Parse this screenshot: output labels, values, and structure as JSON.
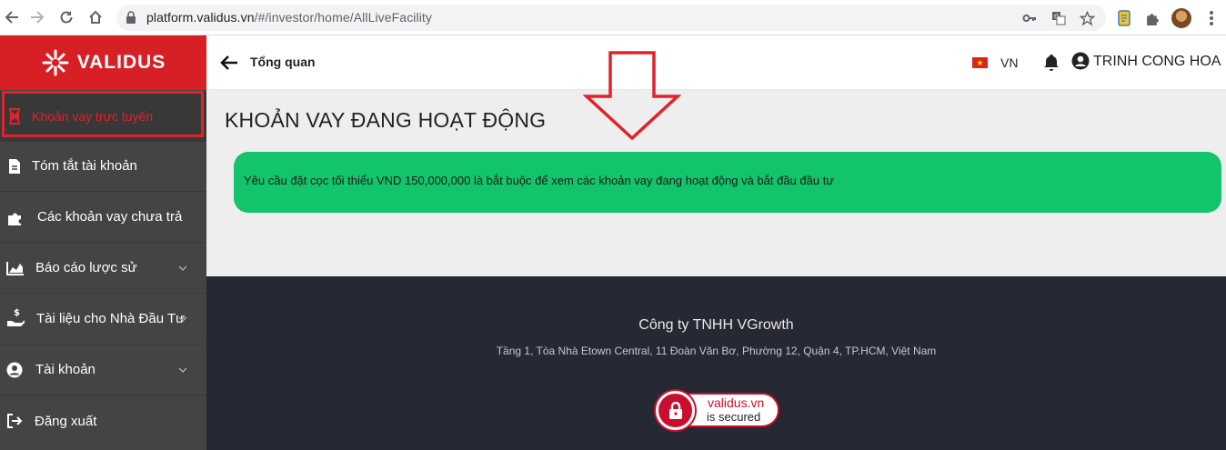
{
  "browser": {
    "url_host": "platform.validus.vn",
    "url_path": "/#/investor/home/AllLiveFacility"
  },
  "brand": {
    "name": "VALIDUS",
    "color": "#d71f26"
  },
  "sidebar": {
    "items": [
      {
        "label": "Khoản vay trực tuyến",
        "icon": "hourglass-icon",
        "active": true
      },
      {
        "label": "Tóm tắt tài khoản",
        "icon": "document-icon"
      },
      {
        "label": "Các khoản vay chưa trả",
        "icon": "puzzle-icon"
      },
      {
        "label": "Báo cáo lược sử",
        "icon": "area-chart-icon",
        "expandable": true
      },
      {
        "label": "Tài liệu cho Nhà Đầu Tư",
        "icon": "hand-money-icon",
        "expandable": true
      },
      {
        "label": "Tài khoản",
        "icon": "user-circle-icon",
        "expandable": true
      },
      {
        "label": "Đăng xuất",
        "icon": "logout-icon"
      }
    ]
  },
  "header": {
    "breadcrumb": "Tổng quan",
    "language": "VN",
    "user_name": "TRINH CONG HOA"
  },
  "main": {
    "title": "KHOẢN VAY ĐANG HOẠT ĐỘNG",
    "notice": "Yêu cầu đặt cọc tối thiểu VND 150,000,000 là bắt buộc để xem các khoản vay đang hoạt động và bắt đầu đầu tư",
    "notice_color": "#12c46b"
  },
  "footer": {
    "company": "Công ty TNHH VGrowth",
    "address": "Tầng 1, Tòa Nhà Etown Central, 11 Đoàn Văn Bơ, Phường 12, Quận 4, TP.HCM, Việt Nam",
    "badge_line1": "validus.vn",
    "badge_line2": "is secured"
  }
}
